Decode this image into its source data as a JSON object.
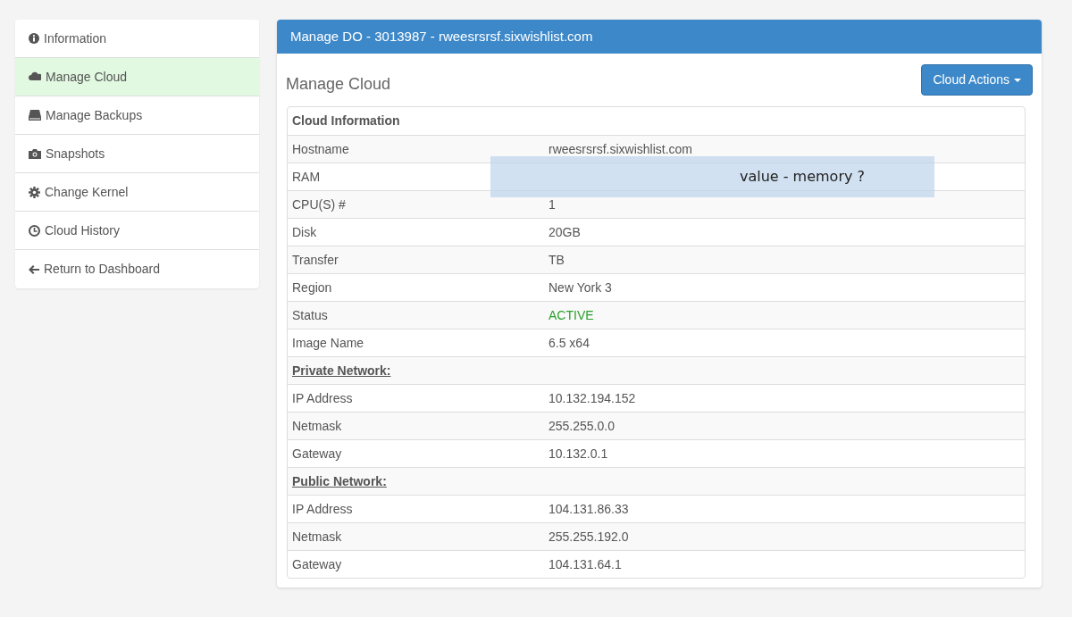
{
  "sidebar": {
    "items": [
      {
        "label": "Information",
        "selected": false
      },
      {
        "label": "Manage Cloud",
        "selected": true
      },
      {
        "label": "Manage Backups",
        "selected": false
      },
      {
        "label": "Snapshots",
        "selected": false
      },
      {
        "label": "Change Kernel",
        "selected": false
      },
      {
        "label": "Cloud History",
        "selected": false
      },
      {
        "label": "Return to Dashboard",
        "selected": false
      }
    ]
  },
  "panel": {
    "title": "Manage DO - 3013987 - rweesrsrsf.sixwishlist.com",
    "heading": "Manage Cloud",
    "actions_button": "Cloud Actions"
  },
  "table": {
    "title": "Cloud Information",
    "rows": [
      {
        "kind": "field",
        "label": "Hostname",
        "value": "rweesrsrsf.sixwishlist.com"
      },
      {
        "kind": "field",
        "label": "RAM"
      },
      {
        "kind": "field",
        "label": "CPU(S) #",
        "value": "1"
      },
      {
        "kind": "field",
        "label": "Disk",
        "value": "20GB"
      },
      {
        "kind": "field",
        "label": "Transfer",
        "value": "TB"
      },
      {
        "kind": "field",
        "label": "Region",
        "value": "New York 3"
      },
      {
        "kind": "status",
        "label": "Status",
        "value": "ACTIVE"
      },
      {
        "kind": "field",
        "label": "Image Name",
        "value": "6.5 x64"
      },
      {
        "kind": "section",
        "label": "Private Network:"
      },
      {
        "kind": "field",
        "label": "IP Address",
        "value": "10.132.194.152"
      },
      {
        "kind": "field",
        "label": "Netmask",
        "value": "255.255.0.0"
      },
      {
        "kind": "field",
        "label": "Gateway",
        "value": "10.132.0.1"
      },
      {
        "kind": "section",
        "label": "Public Network:"
      },
      {
        "kind": "field",
        "label": "IP Address",
        "value": "104.131.86.33"
      },
      {
        "kind": "field",
        "label": "Netmask",
        "value": "255.255.192.0"
      },
      {
        "kind": "field",
        "label": "Gateway",
        "value": "104.131.64.1"
      }
    ]
  },
  "tooltip": {
    "text": "value - memory ?"
  }
}
